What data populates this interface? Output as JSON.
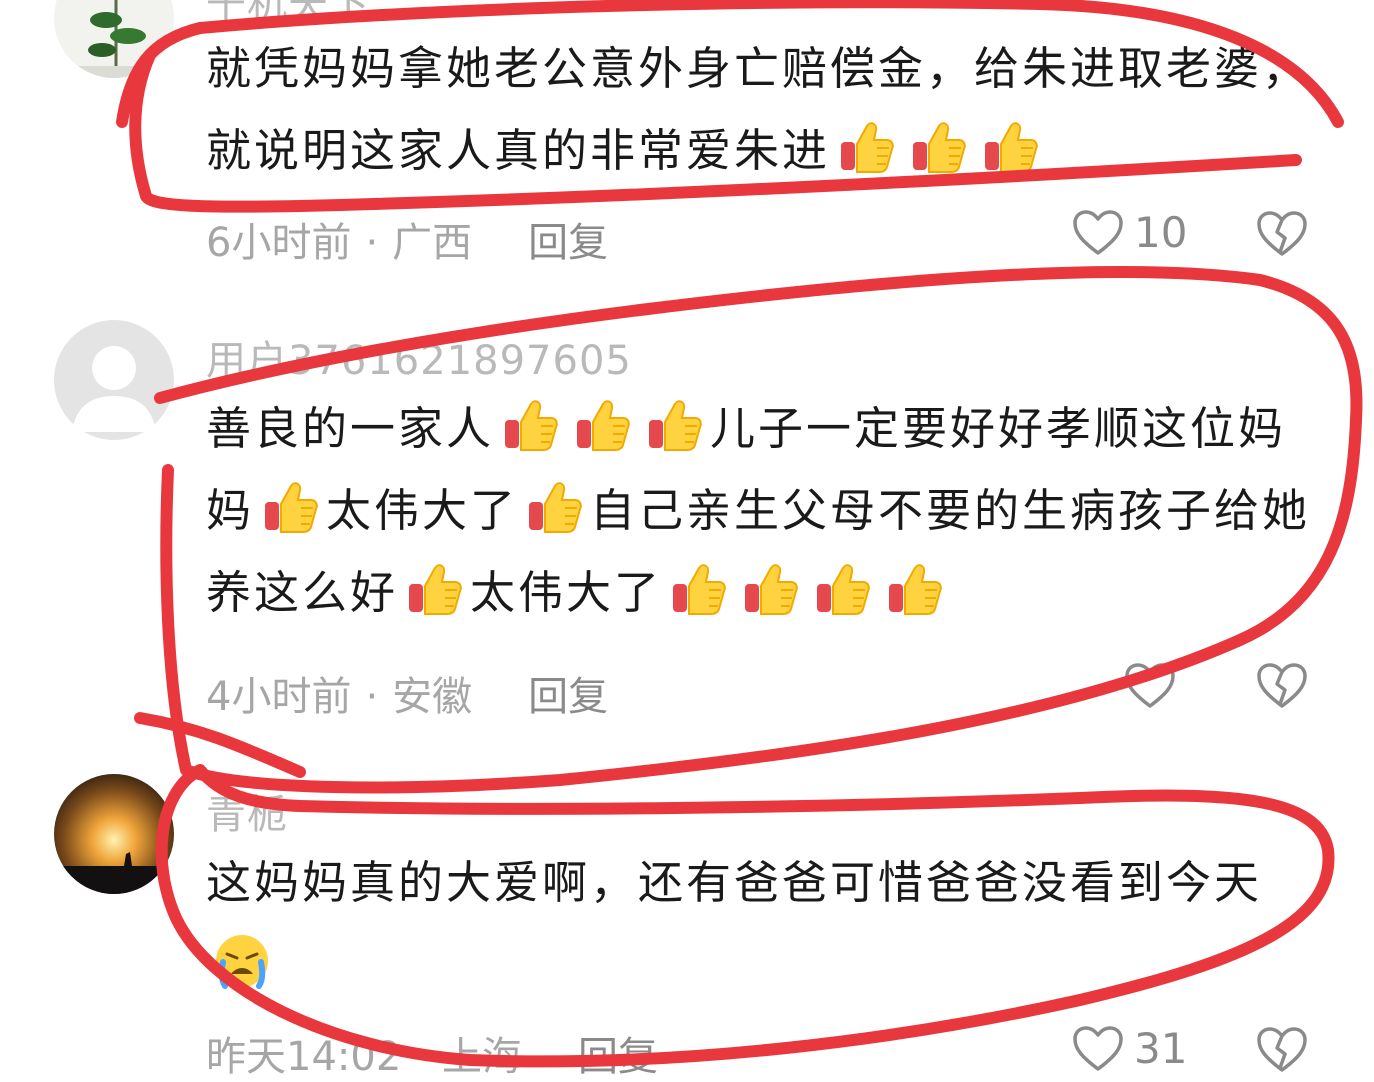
{
  "comments": [
    {
      "username": "千机天下",
      "text_parts": [
        {
          "type": "text",
          "value": "就凭妈妈拿她老公意外身亡赔偿金，给朱进取老婆，就说明这家人真的非常爱朱进"
        },
        {
          "type": "emoji",
          "name": "thumbs-up-emoji"
        },
        {
          "type": "emoji",
          "name": "thumbs-up-emoji"
        },
        {
          "type": "emoji",
          "name": "thumbs-up-emoji"
        }
      ],
      "time": "6小时前",
      "location": "广西",
      "reply_label": "回复",
      "likes": "10"
    },
    {
      "username": "用户3761621897605",
      "text_parts": [
        {
          "type": "text",
          "value": "善良的一家人"
        },
        {
          "type": "emoji",
          "name": "thumbs-up-emoji"
        },
        {
          "type": "emoji",
          "name": "thumbs-up-emoji"
        },
        {
          "type": "emoji",
          "name": "thumbs-up-emoji"
        },
        {
          "type": "text",
          "value": "儿子一定要好好孝顺这位妈妈"
        },
        {
          "type": "emoji",
          "name": "thumbs-up-emoji"
        },
        {
          "type": "text",
          "value": "太伟大了"
        },
        {
          "type": "emoji",
          "name": "thumbs-up-emoji"
        },
        {
          "type": "text",
          "value": "自己亲生父母不要的生病孩子给她养这么好"
        },
        {
          "type": "emoji",
          "name": "thumbs-up-emoji"
        },
        {
          "type": "text",
          "value": "太伟大了"
        },
        {
          "type": "emoji",
          "name": "thumbs-up-emoji"
        },
        {
          "type": "emoji",
          "name": "thumbs-up-emoji"
        },
        {
          "type": "emoji",
          "name": "thumbs-up-emoji"
        },
        {
          "type": "emoji",
          "name": "thumbs-up-emoji"
        }
      ],
      "time": "4小时前",
      "location": "安徽",
      "reply_label": "回复",
      "likes": ""
    },
    {
      "username": "青栀",
      "text_parts": [
        {
          "type": "text",
          "value": "这妈妈真的大爱啊，还有爸爸可惜爸爸没看到今天"
        },
        {
          "type": "emoji",
          "name": "crying-face-emoji"
        }
      ],
      "time": "昨天14:02",
      "location": "上海",
      "reply_label": "回复",
      "likes": "31"
    }
  ],
  "colors": {
    "annotation_red": "#e8383d",
    "muted_text": "#a6a6a6"
  }
}
